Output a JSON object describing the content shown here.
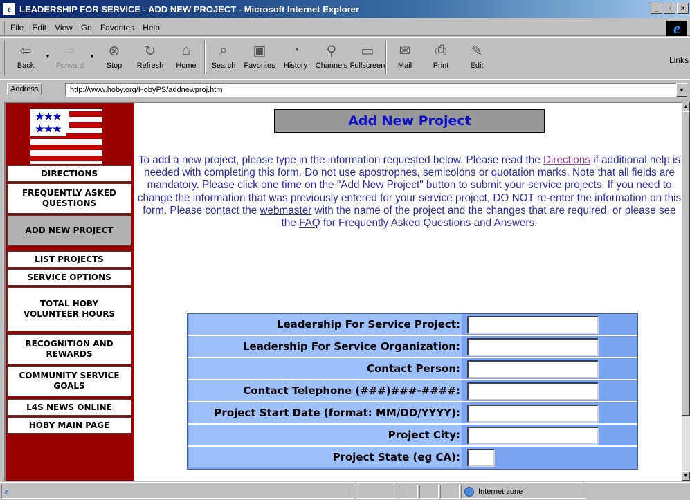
{
  "window": {
    "title": "LEADERSHIP FOR SERVICE - ADD NEW PROJECT - Microsoft Internet Explorer",
    "controls": [
      "_",
      "▫",
      "×"
    ]
  },
  "menu": [
    "File",
    "Edit",
    "View",
    "Go",
    "Favorites",
    "Help"
  ],
  "toolbar": {
    "buttons": [
      {
        "label": "Back",
        "icon": "back-arrow-icon"
      },
      {
        "label": "Forward",
        "icon": "forward-arrow-icon"
      },
      {
        "label": "Stop",
        "icon": "stop-icon"
      },
      {
        "label": "Refresh",
        "icon": "refresh-icon"
      },
      {
        "label": "Home",
        "icon": "home-icon"
      },
      {
        "label": "Search",
        "icon": "search-icon"
      },
      {
        "label": "Favorites",
        "icon": "favorites-icon"
      },
      {
        "label": "History",
        "icon": "history-icon"
      },
      {
        "label": "Channels",
        "icon": "channels-icon"
      },
      {
        "label": "Fullscreen",
        "icon": "fullscreen-icon"
      },
      {
        "label": "Mail",
        "icon": "mail-icon"
      },
      {
        "label": "Print",
        "icon": "print-icon"
      },
      {
        "label": "Edit",
        "icon": "edit-icon"
      }
    ],
    "links_label": "Links"
  },
  "address": {
    "label": "Address",
    "url": "http://www.hoby.org/HobyPS/addnewproj.htm"
  },
  "sidebar": {
    "items": [
      {
        "label": "DIRECTIONS",
        "active": false
      },
      {
        "label": "FREQUENTLY ASKED QUESTIONS",
        "active": false
      },
      {
        "label": "ADD NEW PROJECT",
        "active": true
      },
      {
        "label": "LIST PROJECTS",
        "active": false
      },
      {
        "label": "SERVICE OPTIONS",
        "active": false
      },
      {
        "label": "TOTAL HOBY VOLUNTEER HOURS",
        "active": false
      },
      {
        "label": "RECOGNITION AND REWARDS",
        "active": false
      },
      {
        "label": "COMMUNITY SERVICE GOALS",
        "active": false
      },
      {
        "label": "L4S NEWS ONLINE",
        "active": false
      },
      {
        "label": "HOBY MAIN PAGE",
        "active": false
      }
    ]
  },
  "main": {
    "heading": "Add New Project",
    "intro": {
      "p1": "To add a new project, please type in the information requested below. Please read the ",
      "link_directions": "Directions",
      "p2": " if additional help is needed with completing this form. Do not use apostrophes, semicolons or quotation marks. Note that all fields are mandatory. Please click one time on the \"Add New Project\" button to submit your service projects. If you need to change the information that was previously entered for your service project, DO NOT re-enter the information on this form. Please contact the ",
      "link_webmaster": "webmaster",
      "p3": " with the name of the project and the changes that are required, or please see the ",
      "link_faq": "FAQ",
      "p4": " for Frequently Asked Questions and Answers."
    },
    "form_fields": [
      {
        "label": "Leadership For Service Project:",
        "value": ""
      },
      {
        "label": "Leadership For Service Organization:",
        "value": ""
      },
      {
        "label": "Contact Person:",
        "value": ""
      },
      {
        "label": "Contact Telephone (###)###-####:",
        "value": ""
      },
      {
        "label": "Project Start Date (format: MM/DD/YYYY):",
        "value": ""
      },
      {
        "label": "Project City:",
        "value": ""
      },
      {
        "label": "Project State (eg CA):",
        "value": ""
      }
    ]
  },
  "status": {
    "main_text": "",
    "zone": "Internet zone"
  }
}
